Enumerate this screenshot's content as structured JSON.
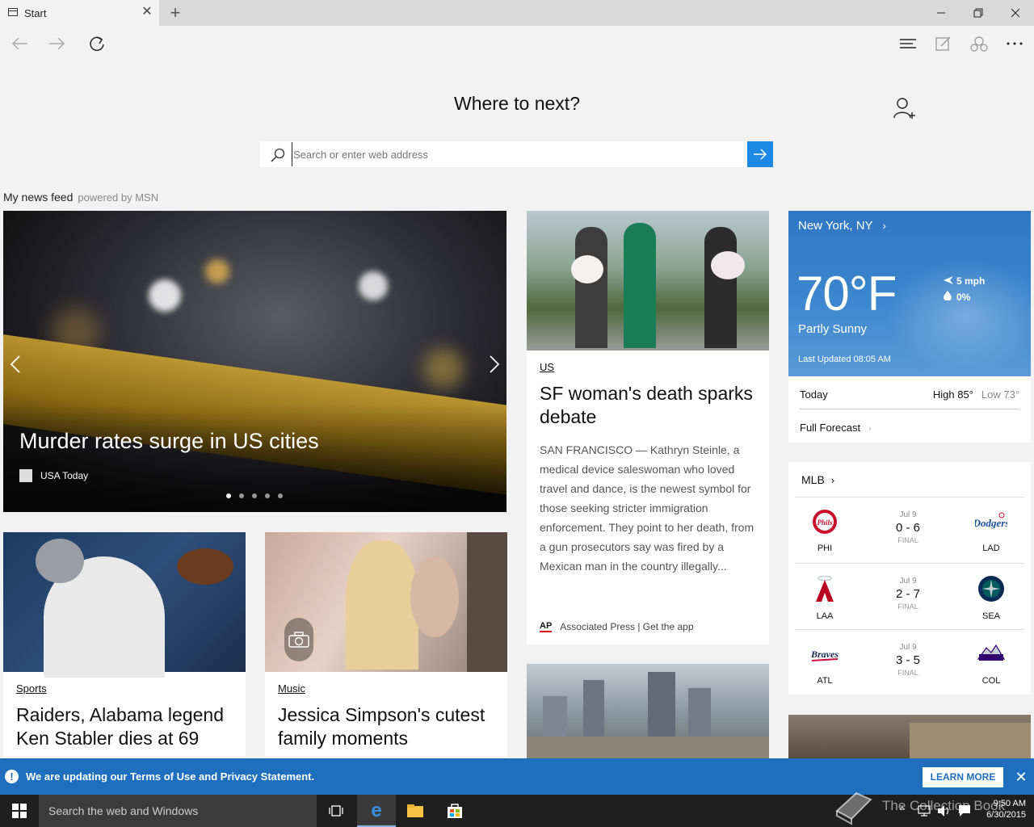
{
  "browser": {
    "tab_title": "Start",
    "nav": {
      "back": "back-arrow-icon",
      "forward": "forward-arrow-icon",
      "refresh": "refresh-icon"
    },
    "toolbar": [
      "hub-icon",
      "web-note-icon",
      "share-icon",
      "more-icon"
    ]
  },
  "start": {
    "heading": "Where to next?",
    "search_placeholder": "Search or enter web address",
    "feed_title": "My news feed",
    "feed_powered": "powered by MSN"
  },
  "hero": {
    "headline": "Murder rates surge in US cities",
    "source": "USA Today",
    "slides": 5,
    "active_slide": 1
  },
  "story_main": {
    "category": "US",
    "headline": "SF woman's death sparks debate",
    "body": "SAN FRANCISCO — Kathryn Steinle, a medical device saleswoman who loved travel and dance, is the newest symbol for those seeking stricter immigration enforcement. They point to her death, from a gun prosecutors say was fired by a Mexican man in the country illegally...",
    "source_logo": "AP",
    "source": "Associated Press | Get the app"
  },
  "story_sports": {
    "category": "Sports",
    "headline": "Raiders, Alabama legend Ken Stabler dies at 69"
  },
  "story_music": {
    "category": "Music",
    "headline": "Jessica Simpson's cutest family moments"
  },
  "weather": {
    "location": "New York, NY",
    "temp": "70°F",
    "condition": "Partly Sunny",
    "updated": "Last Updated 08:05 AM",
    "wind": "5 mph",
    "precip": "0%",
    "today_label": "Today",
    "high": "High 85°",
    "low": "Low 73°",
    "forecast_link": "Full Forecast"
  },
  "mlb": {
    "title": "MLB",
    "games": [
      {
        "date": "Jul 9",
        "score": "0 - 6",
        "status": "FINAL",
        "home": "PHI",
        "away": "LAD"
      },
      {
        "date": "Jul 9",
        "score": "2 - 7",
        "status": "FINAL",
        "home": "LAA",
        "away": "SEA"
      },
      {
        "date": "Jul 9",
        "score": "3 - 5",
        "status": "FINAL",
        "home": "ATL",
        "away": "COL"
      }
    ]
  },
  "notification": {
    "text": "We are updating our Terms of Use and Privacy Statement.",
    "button": "LEARN MORE"
  },
  "taskbar": {
    "search_placeholder": "Search the web and Windows",
    "time": "9:50 AM",
    "date": "6/30/2015",
    "watermark": "The Collection Book"
  },
  "colors": {
    "accent": "#1e88e5",
    "notify_bg": "#1f6fbf",
    "weather_bg": "#3d87cf",
    "taskbar_bg": "#1f1f1f"
  }
}
